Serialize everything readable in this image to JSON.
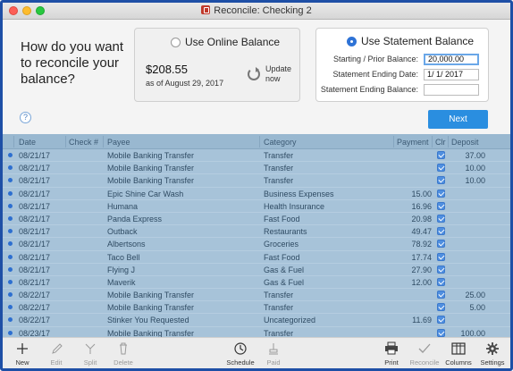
{
  "window": {
    "title": "Reconcile: Checking 2"
  },
  "header": {
    "question": "How do you want to reconcile your balance?",
    "online": {
      "label": "Use Online Balance",
      "amount": "$208.55",
      "as_of": "as of August 29, 2017",
      "update": "Update now"
    },
    "statement": {
      "label": "Use Statement Balance",
      "starting_label": "Starting / Prior Balance:",
      "starting_value": "20,000.00",
      "ending_date_label": "Statement Ending Date:",
      "ending_date_value": "1/  1/ 2017",
      "ending_balance_label": "Statement Ending Balance:",
      "ending_balance_value": ""
    },
    "help": "?",
    "next": "Next"
  },
  "table": {
    "columns": [
      "Date",
      "Check #",
      "Payee",
      "Category",
      "Payment",
      "Clr",
      "Deposit"
    ],
    "rows": [
      {
        "date": "08/21/17",
        "check": "",
        "payee": "Mobile Banking Transfer",
        "category": "Transfer",
        "payment": "",
        "deposit": "37.00"
      },
      {
        "date": "08/21/17",
        "check": "",
        "payee": "Mobile Banking Transfer",
        "category": "Transfer",
        "payment": "",
        "deposit": "10.00"
      },
      {
        "date": "08/21/17",
        "check": "",
        "payee": "Mobile Banking Transfer",
        "category": "Transfer",
        "payment": "",
        "deposit": "10.00"
      },
      {
        "date": "08/21/17",
        "check": "",
        "payee": "Epic Shine Car Wash",
        "category": "Business Expenses",
        "payment": "15.00",
        "deposit": ""
      },
      {
        "date": "08/21/17",
        "check": "",
        "payee": "Humana",
        "category": "Health Insurance",
        "payment": "16.96",
        "deposit": ""
      },
      {
        "date": "08/21/17",
        "check": "",
        "payee": "Panda Express",
        "category": "Fast Food",
        "payment": "20.98",
        "deposit": ""
      },
      {
        "date": "08/21/17",
        "check": "",
        "payee": "Outback",
        "category": "Restaurants",
        "payment": "49.47",
        "deposit": ""
      },
      {
        "date": "08/21/17",
        "check": "",
        "payee": "Albertsons",
        "category": "Groceries",
        "payment": "78.92",
        "deposit": ""
      },
      {
        "date": "08/21/17",
        "check": "",
        "payee": "Taco Bell",
        "category": "Fast Food",
        "payment": "17.74",
        "deposit": ""
      },
      {
        "date": "08/21/17",
        "check": "",
        "payee": "Flying J",
        "category": "Gas & Fuel",
        "payment": "27.90",
        "deposit": ""
      },
      {
        "date": "08/21/17",
        "check": "",
        "payee": "Maverik",
        "category": "Gas & Fuel",
        "payment": "12.00",
        "deposit": ""
      },
      {
        "date": "08/22/17",
        "check": "",
        "payee": "Mobile Banking Transfer",
        "category": "Transfer",
        "payment": "",
        "deposit": "25.00"
      },
      {
        "date": "08/22/17",
        "check": "",
        "payee": "Mobile Banking Transfer",
        "category": "Transfer",
        "payment": "",
        "deposit": "5.00"
      },
      {
        "date": "08/22/17",
        "check": "",
        "payee": "Stinker You Requested",
        "category": "Uncategorized",
        "payment": "11.69",
        "deposit": ""
      },
      {
        "date": "08/23/17",
        "check": "",
        "payee": "Mobile Banking Transfer",
        "category": "Transfer",
        "payment": "",
        "deposit": "100.00"
      }
    ]
  },
  "toolbar": {
    "new": "New",
    "edit": "Edit",
    "split": "Split",
    "delete": "Delete",
    "schedule": "Schedule",
    "paid": "Paid",
    "print": "Print",
    "reconcile": "Reconcile",
    "columns": "Columns",
    "settings": "Settings"
  }
}
